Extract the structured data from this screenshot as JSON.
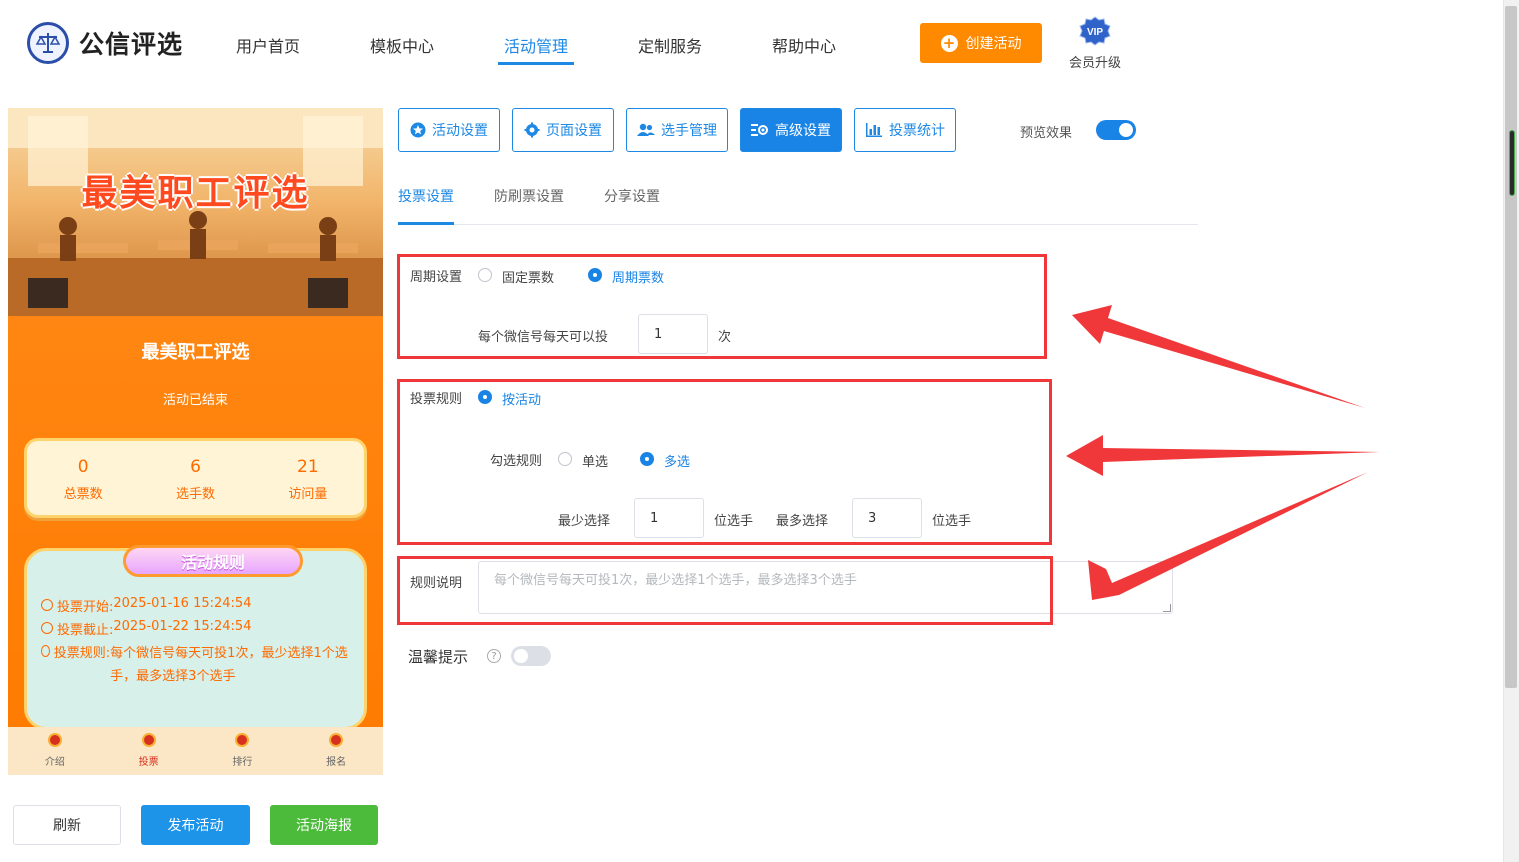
{
  "header": {
    "logo_text": "公信评选",
    "nav": [
      "用户首页",
      "模板中心",
      "活动管理",
      "定制服务",
      "帮助中心"
    ],
    "active_nav": "活动管理",
    "create_button": "创建活动",
    "vip_badge": "VIP",
    "vip_label": "会员升级"
  },
  "preview": {
    "banner_title": "最美职工评选",
    "activity_title": "最美职工评选",
    "status": "活动已结束",
    "stats": [
      {
        "value": "0",
        "label": "总票数"
      },
      {
        "value": "6",
        "label": "选手数"
      },
      {
        "value": "21",
        "label": "访问量"
      }
    ],
    "rules_title": "活动规则",
    "rules": {
      "start_key": "投票开始:",
      "start_val": "2025-01-16 15:24:54",
      "end_key": "投票截止:",
      "end_val": "2025-01-22 15:24:54",
      "rule_key": "投票规则:",
      "rule_val": "每个微信号每天可投1次，最少选择1个选手，最多选择3个选手"
    },
    "tabbar": [
      "介绍",
      "投票",
      "排行",
      "报名"
    ],
    "active_tab": "投票"
  },
  "bottom_buttons": {
    "refresh": "刷新",
    "publish": "发布活动",
    "poster": "活动海报"
  },
  "settings_tabs": [
    "活动设置",
    "页面设置",
    "选手管理",
    "高级设置",
    "投票统计"
  ],
  "active_settings_tab": "高级设置",
  "preview_toggle_label": "预览效果",
  "preview_toggle_on": true,
  "sub_tabs": [
    "投票设置",
    "防刷票设置",
    "分享设置"
  ],
  "active_sub_tab": "投票设置",
  "form": {
    "cycle_label": "周期设置",
    "cycle_options": [
      "固定票数",
      "周期票数"
    ],
    "cycle_selected": "周期票数",
    "daily_label": "每个微信号每天可以投",
    "daily_value": "1",
    "daily_unit": "次",
    "rule_label": "投票规则",
    "rule_option": "按活动",
    "check_label": "勾选规则",
    "check_options": [
      "单选",
      "多选"
    ],
    "check_selected": "多选",
    "min_label": "最少选择",
    "min_value": "1",
    "min_unit": "位选手",
    "max_label": "最多选择",
    "max_value": "3",
    "max_unit": "位选手",
    "desc_label": "规则说明",
    "desc_placeholder": "每个微信号每天可投1次，最少选择1个选手，最多选择3个选手",
    "tip_label": "温馨提示",
    "tip_help": "?",
    "tip_on": false
  },
  "colors": {
    "primary": "#1a84e6",
    "orange": "#ff8a00",
    "green": "#4cbb3c",
    "highlight_red": "#f0383b"
  }
}
